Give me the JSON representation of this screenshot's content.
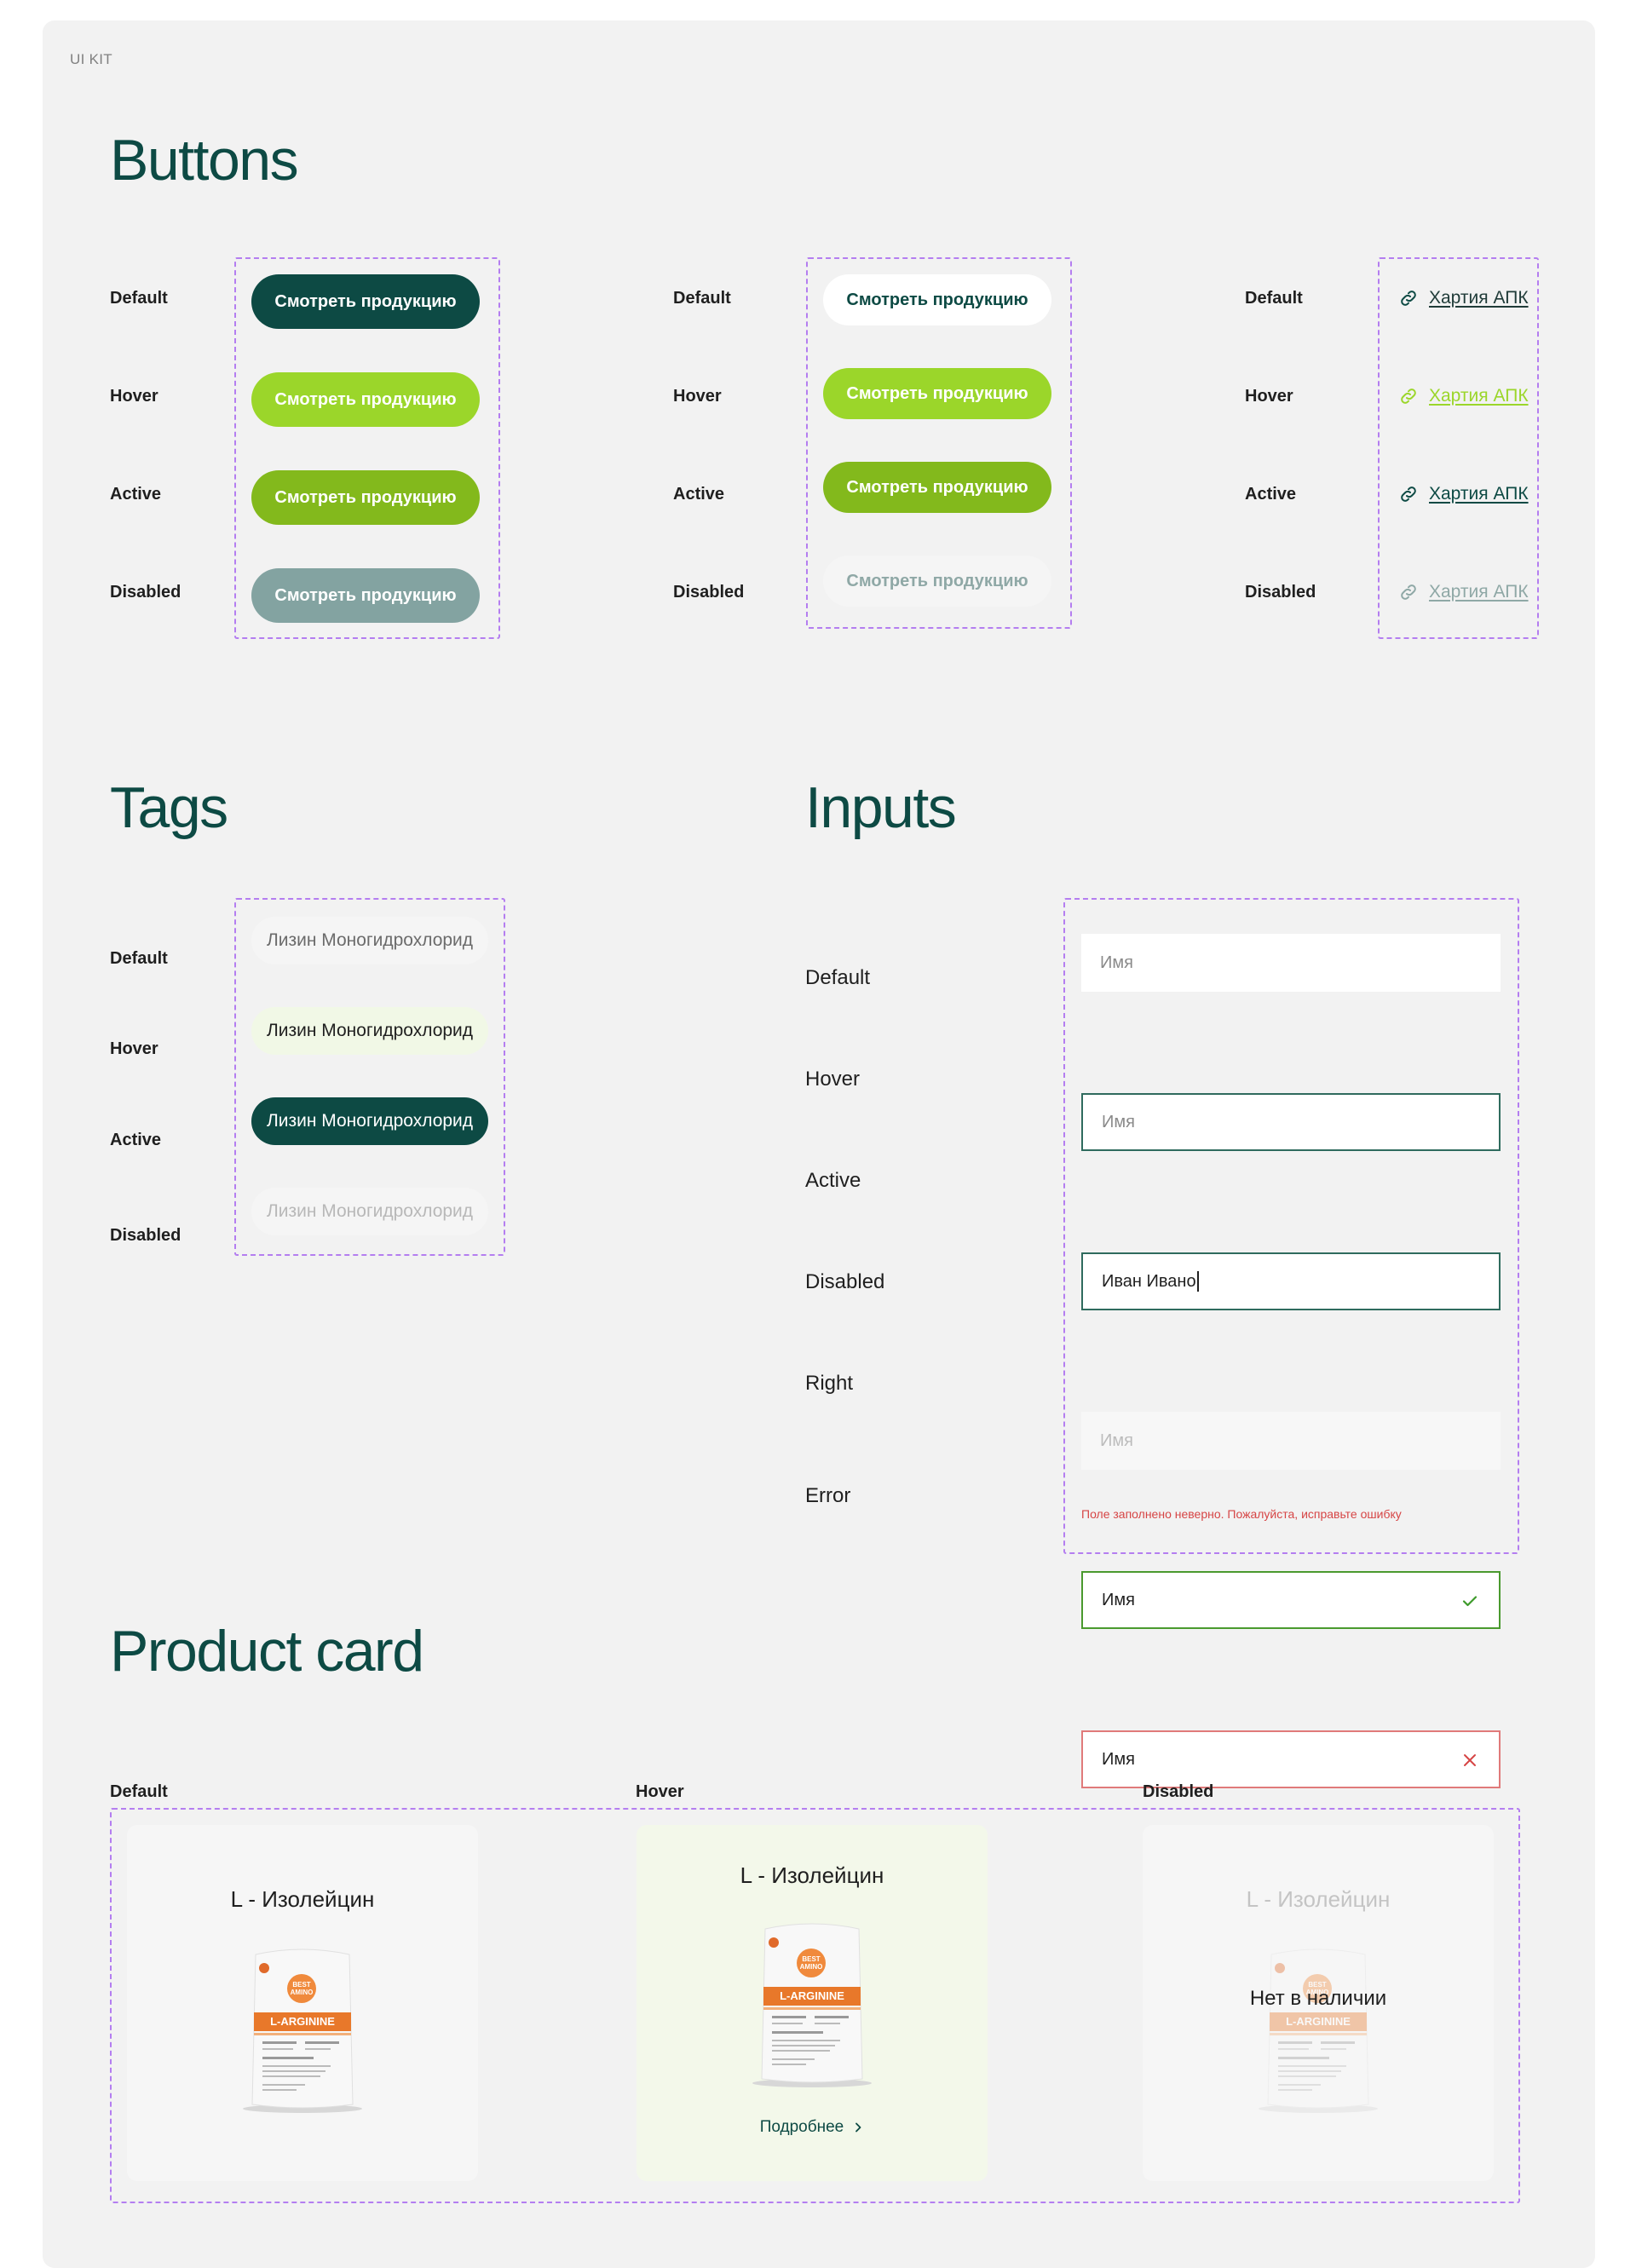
{
  "kit_label": "UI KIT",
  "buttons": {
    "title": "Buttons",
    "states": [
      "Default",
      "Hover",
      "Active",
      "Disabled"
    ],
    "button_label": "Смотреть продукцию",
    "link_label": "Хартия АПК",
    "colors": {
      "primary_default": "#0d4a44",
      "primary_hover": "#9bd62a",
      "primary_active": "#83b91c",
      "primary_disabled": "#83a3a1",
      "link_hover": "#9bd62a"
    }
  },
  "tags": {
    "title": "Tags",
    "states": [
      "Default",
      "Hover",
      "Active",
      "Disabled"
    ],
    "tag_label": "Лизин Моногидрохлорид"
  },
  "inputs": {
    "title": "Inputs",
    "states": [
      "Default",
      "Hover",
      "Active",
      "Disabled",
      "Right",
      "Error"
    ],
    "placeholder": "Имя",
    "active_value": "Иван Ивано",
    "filled_value": "Имя",
    "error_message": "Поле заполнено неверно. Пожалуйста, исправьте ошибку"
  },
  "product_card": {
    "title": "Product card",
    "states": [
      "Default",
      "Hover",
      "Disabled"
    ],
    "product_name": "L - Изолейцин",
    "bag_brand": "BEST AMINO",
    "bag_product": "L-ARGININE",
    "more_label": "Подробнее",
    "out_of_stock": "Нет в наличии"
  }
}
